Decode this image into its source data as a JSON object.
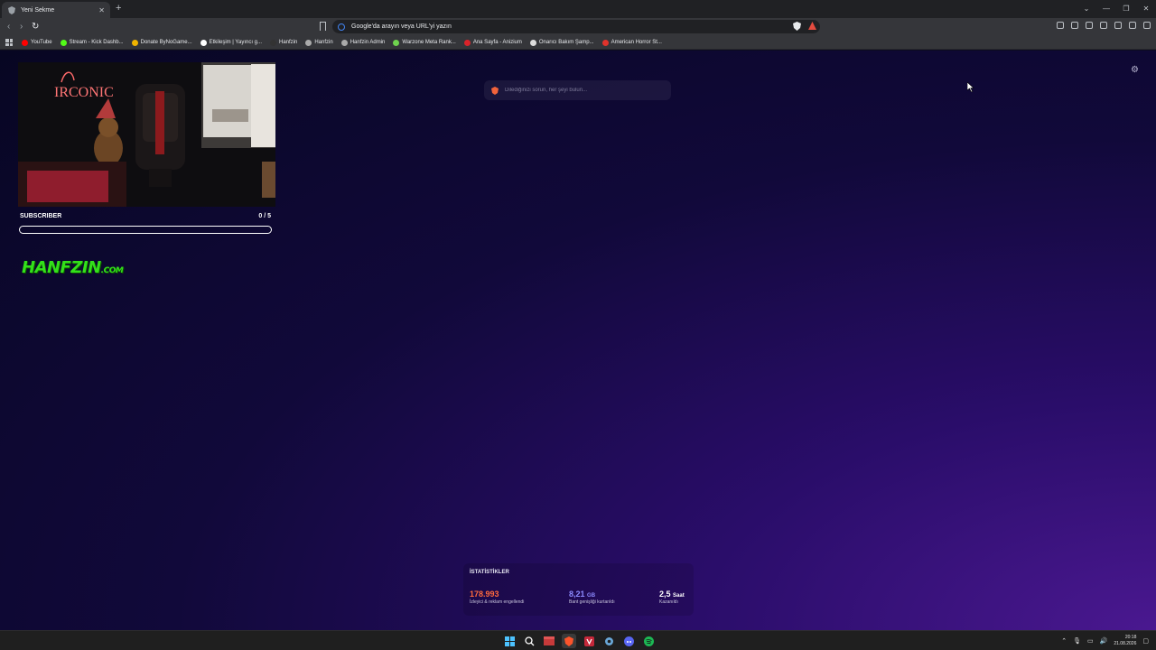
{
  "tab": {
    "title": "Yeni Sekme"
  },
  "omnibox": {
    "placeholder": "Google'da arayın veya URL'yi yazın"
  },
  "bookmarks": [
    {
      "label": "YouTube",
      "color": "#ff0000"
    },
    {
      "label": "Stream - Kick Dashb...",
      "color": "#53fc18"
    },
    {
      "label": "Donate ByNoGame...",
      "color": "#f0b400"
    },
    {
      "label": "Etkileşim | Yayıncı g...",
      "color": "#ffffff"
    },
    {
      "label": "Hanfzin",
      "color": "#333333"
    },
    {
      "label": "Hanfzin",
      "color": "#aaaaaa"
    },
    {
      "label": "Hanfzin Admin",
      "color": "#aaaaaa"
    },
    {
      "label": "Warzone Meta Rank...",
      "color": "#6fd34e"
    },
    {
      "label": "Ana Sayfa - Anizium",
      "color": "#d9232a"
    },
    {
      "label": "Onarıcı Bakım Şamp...",
      "color": "#dddddd"
    },
    {
      "label": "American Horror St...",
      "color": "#e0332c"
    }
  ],
  "widget": {
    "goal_label": "SUBSCRIBER",
    "goal_count": "0 / 5",
    "progress_fraction": 0,
    "stream_sign": "IRCONIC"
  },
  "logo": {
    "main": "HANFZIN",
    "suffix": ".COM"
  },
  "search": {
    "placeholder": "Dilediğinizi sorun, her şeyi bulun..."
  },
  "stats": {
    "title": "İSTATİSTİKLER",
    "trackers_value": "178.993",
    "trackers_label": "İzleyici & reklam engellendi",
    "bandwidth_value": "8,21",
    "bandwidth_unit": "GB",
    "bandwidth_label": "Bant genişliği kurtarıldı",
    "time_value": "2,5",
    "time_unit": "Saat",
    "time_label": "Kazanıldı",
    "colors": {
      "trackers": "#ff6a3d",
      "bandwidth": "#8d8bff",
      "time": "#ffffff"
    }
  },
  "clock": {
    "time": "20:18",
    "date": "21.08.2026"
  }
}
